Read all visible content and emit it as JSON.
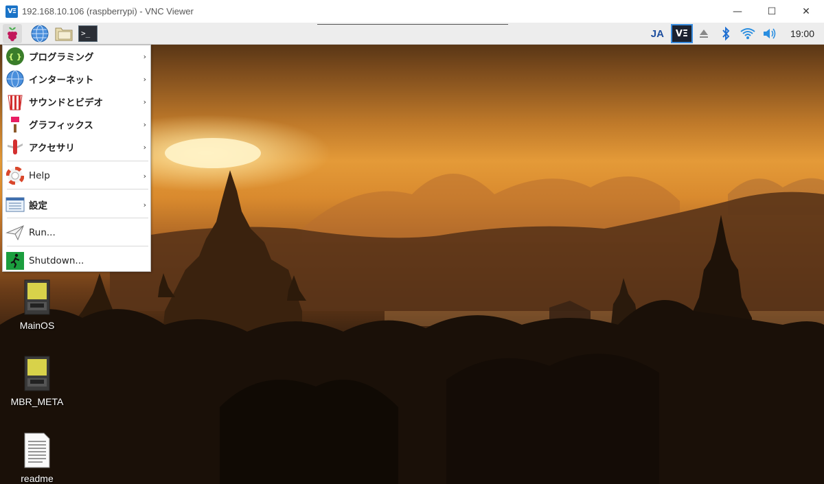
{
  "window": {
    "app_icon_text": "VΞ",
    "title": "192.168.10.106 (raspberrypi) - VNC Viewer",
    "controls": {
      "minimize": "—",
      "maximize": "☐",
      "close": "✕"
    }
  },
  "panel": {
    "launchers": [
      "raspberry-menu",
      "web-browser",
      "file-manager",
      "terminal"
    ],
    "terminal_glyph": ">_",
    "tray": {
      "language": "JA",
      "vnc_icon_text": "VΞ",
      "clock": "19:00"
    }
  },
  "menu": {
    "arrow": "›",
    "items": [
      {
        "label": "プログラミング",
        "icon": "programming-icon",
        "submenu": true
      },
      {
        "label": "インターネット",
        "icon": "internet-icon",
        "submenu": true
      },
      {
        "label": "サウンドとビデオ",
        "icon": "sound-video-icon",
        "submenu": true
      },
      {
        "label": "グラフィックス",
        "icon": "graphics-icon",
        "submenu": true
      },
      {
        "label": "アクセサリ",
        "icon": "accessories-icon",
        "submenu": true
      },
      {
        "label": "Help",
        "icon": "help-icon",
        "submenu": true
      },
      {
        "label": "設定",
        "icon": "settings-icon",
        "submenu": true
      },
      {
        "label": "Run...",
        "icon": "run-icon",
        "submenu": false
      },
      {
        "label": "Shutdown...",
        "icon": "shutdown-icon",
        "submenu": false
      }
    ],
    "programming_glyph": "{ }"
  },
  "desktop": {
    "icons": [
      {
        "label": "MainOS",
        "icon": "sd-card-icon"
      },
      {
        "label": "MBR_META",
        "icon": "sd-card-icon"
      },
      {
        "label": "readme",
        "icon": "text-file-icon"
      }
    ]
  },
  "colors": {
    "accent_blue": "#1d4e9e",
    "vnc_blue": "#1a73c7",
    "panel_bg": "#ededed"
  }
}
